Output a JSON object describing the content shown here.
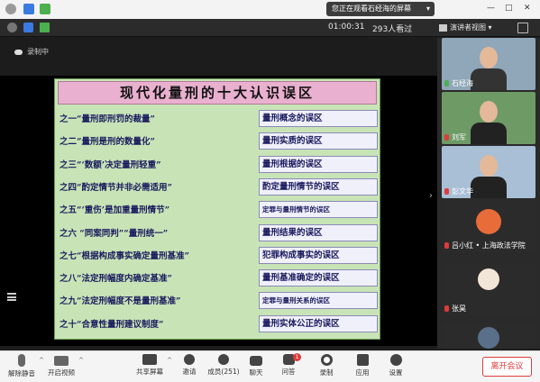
{
  "topbar": {
    "share_notice": "您正在观看石经海的屏幕",
    "share_chevron": "▾",
    "minimize": "—",
    "maximize": "□",
    "close": "✕"
  },
  "infobar": {
    "timer": "01:00:31",
    "viewers": "293人看过",
    "view_mode": "演讲者视图",
    "view_chevron": "▾"
  },
  "recording": "录制中",
  "slide": {
    "title": "现代化量刑的十大认识误区",
    "rows": [
      {
        "left": "之一“量刑即刑罚的裁量”",
        "right": "量刑概念的误区",
        "small": false
      },
      {
        "left": "之二“量刑是刑的数量化”",
        "right": "量刑实质的误区",
        "small": false
      },
      {
        "left": "之三“‘数额’决定量刑轻重”",
        "right": "量刑根据的误区",
        "small": false
      },
      {
        "left": "之四“酌定情节并非必需适用”",
        "right": "酌定量刑情节的误区",
        "small": false
      },
      {
        "left": "之五“‘重伤’是加重量刑情节”",
        "right": "定罪与量刑情节的误区",
        "small": true
      },
      {
        "left": "之六 “同案同判”“量刑统一”",
        "right": "量刑结果的误区",
        "small": false
      },
      {
        "left": "之七“根据构成事实确定量刑基准”",
        "right": "犯罪构成事实的误区",
        "small": false
      },
      {
        "left": "之八“法定刑幅度内确定基准”",
        "right": "量刑基准确定的误区",
        "small": false
      },
      {
        "left": "之九“法定刑幅度不是量刑基准”",
        "right": "定罪与量刑关系的误区",
        "small": true
      },
      {
        "left": "之十“合意性量刑建议制度”",
        "right": "量刑实体公正的误区",
        "small": false
      }
    ]
  },
  "participants": [
    {
      "name": "石经海",
      "mic": "on",
      "bg": "#8fa7b8"
    },
    {
      "name": "刘军",
      "mic": "off",
      "bg": "#6e9a66"
    },
    {
      "name": "彭文华",
      "mic": "off",
      "bg": "#a9bfd6"
    },
    {
      "name": "吕小红 • 上海政法学院",
      "mic": "off",
      "bg": "#2b2b2b"
    },
    {
      "name": "张昊",
      "mic": "off",
      "bg": "#2b2b2b"
    }
  ],
  "toolbar": {
    "mute": "解除静音",
    "video": "开启视频",
    "share": "共享屏幕",
    "invite": "邀请",
    "members": "成员(251)",
    "chat": "聊天",
    "qa": "问答",
    "qa_badge": "1",
    "record": "录制",
    "apps": "应用",
    "settings": "设置",
    "leave": "离开会议",
    "chevron": "^"
  },
  "colors": {
    "accent_red": "#e03a3a",
    "mic_green": "#4caf50",
    "slide_bg": "#c8e4b6",
    "title_bg": "#e9b0cf"
  }
}
